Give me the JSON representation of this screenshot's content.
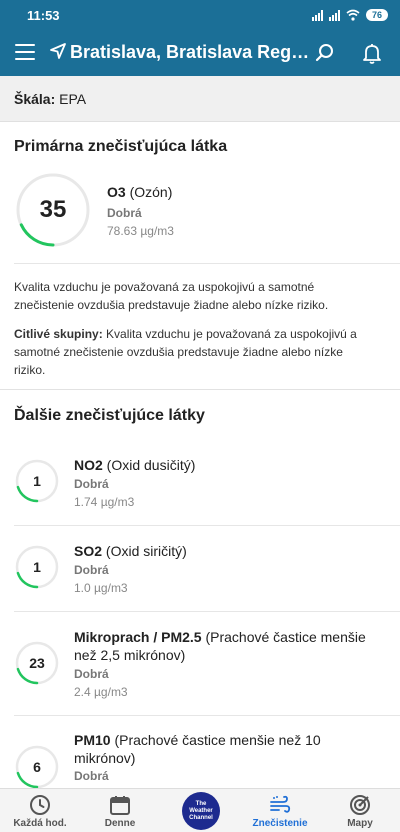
{
  "status_bar": {
    "time": "11:53",
    "battery": "76"
  },
  "app_bar": {
    "location": "Bratislava, Bratislava Region ..."
  },
  "scale": {
    "label": "Škála:",
    "value": "EPA"
  },
  "primary": {
    "title": "Primárna znečisťujúca látka",
    "aqi": "35",
    "aqi_fraction": 0.18,
    "name_bold": "O3",
    "name_rest": " (Ozón)",
    "status": "Dobrá",
    "value": "78.63 µg/m3",
    "description": "Kvalita vzduchu je považovaná za uspokojivú a samotné znečistenie ovzdušia predstavuje žiadne alebo nízke riziko.",
    "sensitive_label": "Citlivé skupiny:",
    "sensitive_text": " Kvalita vzduchu je považovaná za uspokojivú a samotné znečistenie ovzdušia predstavuje žiadne alebo nízke riziko."
  },
  "others": {
    "title": "Ďalšie znečisťujúce látky",
    "items": [
      {
        "aqi": "1",
        "fraction": 0.2,
        "name_bold": "NO2",
        "name_rest": " (Oxid dusičitý)",
        "status": "Dobrá",
        "value": "1.74 µg/m3"
      },
      {
        "aqi": "1",
        "fraction": 0.2,
        "name_bold": "SO2",
        "name_rest": " (Oxid siričitý)",
        "status": "Dobrá",
        "value": "1.0 µg/m3"
      },
      {
        "aqi": "23",
        "fraction": 0.2,
        "name_bold": "Mikroprach / PM2.5",
        "name_rest": " (Prachové častice menšie než 2,5 mikrónov)",
        "status": "Dobrá",
        "value": "2.4 µg/m3"
      },
      {
        "aqi": "6",
        "fraction": 0.2,
        "name_bold": "PM10",
        "name_rest": " (Prachové častice menšie než 10 mikrónov)",
        "status": "Dobrá",
        "value": ""
      }
    ]
  },
  "bottom_nav": {
    "hourly": "Každá hod.",
    "daily": "Denne",
    "logo_line1": "The",
    "logo_line2": "Weather",
    "logo_line3": "Channel",
    "pollution": "Znečistenie",
    "maps": "Mapy"
  },
  "colors": {
    "brand": "#1b6f97",
    "good": "#22c55e",
    "active": "#1f6fd6"
  }
}
